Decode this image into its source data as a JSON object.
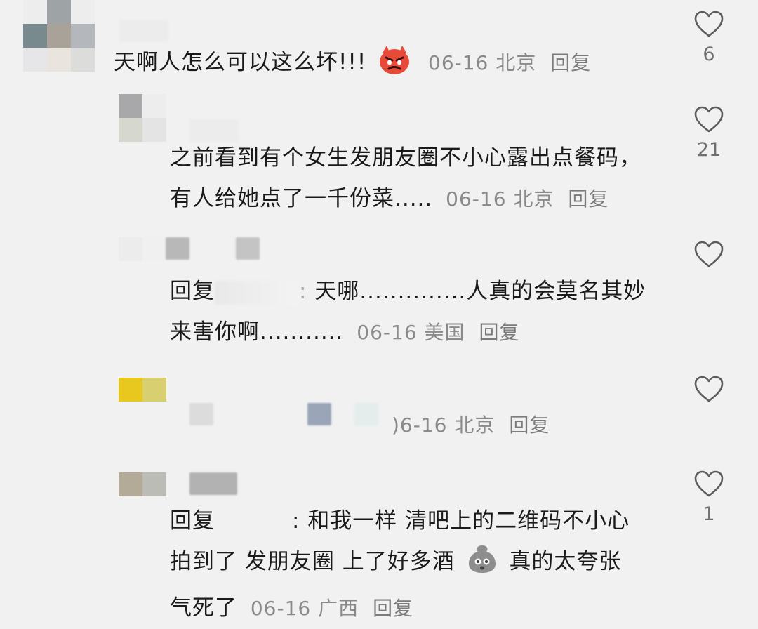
{
  "comments": [
    {
      "text": "天啊人怎么可以这么坏!!!",
      "emoji": "angry-devil",
      "date": "06-16",
      "location": "北京",
      "reply_label": "回复",
      "likes": "6"
    },
    {
      "text": "之前看到有个女生发朋友圈不小心露出点餐码，有人给她点了一千份菜.....",
      "date": "06-16",
      "location": "北京",
      "reply_label": "回复",
      "likes": "21"
    },
    {
      "prefix": "回复",
      "text_line1": "天哪..............人真的会莫名其妙",
      "text_line2": "来害你啊...........",
      "date": "06-16",
      "location": "美国",
      "reply_label": "回复",
      "likes": ""
    },
    {
      "date_partial": ")6-16",
      "location": "北京",
      "reply_label": "回复",
      "likes": ""
    },
    {
      "prefix": "回复",
      "text_line1": "和我一样 清吧上的二维码不小心",
      "text_line2a": "拍到了 发朋友圈 上了好多酒",
      "emoji": "sad-face",
      "text_line2b": "真的太夸张",
      "text_line3": "气死了",
      "date": "06-16",
      "location": "广西",
      "reply_label": "回复",
      "likes": "1"
    }
  ],
  "colors": {
    "background": "#f1f1f1",
    "text": "#1a1a1a",
    "meta": "#8a8a8a",
    "heart": "#5c5c5c"
  }
}
